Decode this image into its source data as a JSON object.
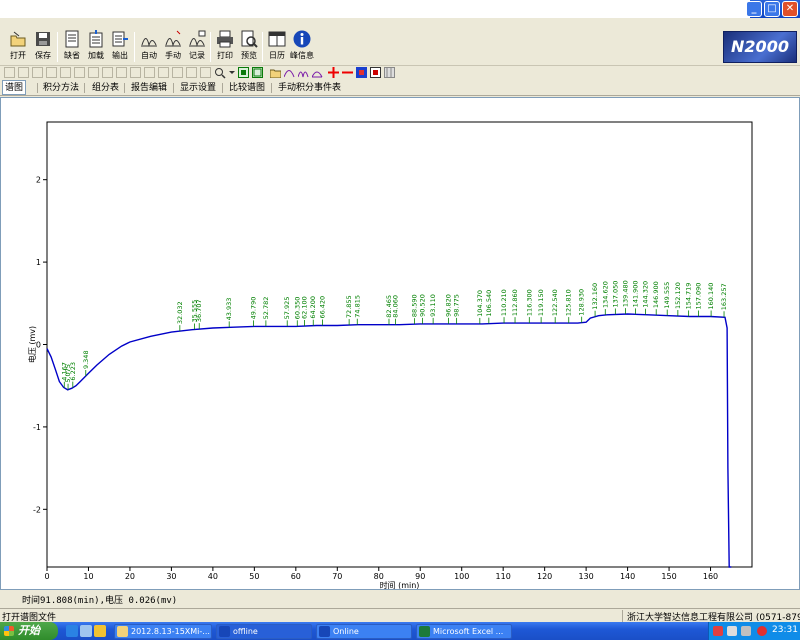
{
  "window": {
    "minimize_symbol": "_",
    "maximize_symbol": "□",
    "close_symbol": "✕"
  },
  "toolbar": {
    "buttons": [
      {
        "label": "打开",
        "icon": "open-icon"
      },
      {
        "label": "保存",
        "icon": "save-icon"
      },
      {
        "label": "缺省",
        "icon": "default-icon"
      },
      {
        "label": "加载",
        "icon": "load-icon"
      },
      {
        "label": "输出",
        "icon": "export-icon"
      },
      {
        "label": "自动",
        "icon": "auto-integrate-icon"
      },
      {
        "label": "手动",
        "icon": "manual-integrate-icon"
      },
      {
        "label": "记录",
        "icon": "record-icon"
      },
      {
        "label": "打印",
        "icon": "printer-icon"
      },
      {
        "label": "预览",
        "icon": "preview-icon"
      },
      {
        "label": "日历",
        "icon": "calendar-icon"
      },
      {
        "label": "峰信息",
        "icon": "info-icon"
      }
    ],
    "logo_text": "N2000"
  },
  "tabs": [
    {
      "label": "谱图",
      "active": true
    },
    {
      "label": "积分方法",
      "active": false
    },
    {
      "label": "组分表",
      "active": false
    },
    {
      "label": "报告编辑",
      "active": false
    },
    {
      "label": "显示设置",
      "active": false
    },
    {
      "label": "比较谱图",
      "active": false
    },
    {
      "label": "手动积分事件表",
      "active": false
    }
  ],
  "chart_data": {
    "type": "line",
    "xlabel": "时间 (min)",
    "ylabel": "电压 (mv)",
    "xlim": [
      0,
      170
    ],
    "ylim": [
      -2.7,
      2.7
    ],
    "xticks": [
      0,
      10,
      20,
      30,
      40,
      50,
      60,
      70,
      80,
      90,
      100,
      110,
      120,
      130,
      140,
      150,
      160
    ],
    "yticks": [
      -2,
      -1,
      0,
      1,
      2
    ],
    "line_color": "#0000c8",
    "peak_label_color": "#008000",
    "series": [
      {
        "x": [
          0,
          1,
          2,
          3,
          4,
          5,
          6,
          7,
          8,
          10,
          12,
          15,
          18,
          20,
          25,
          30,
          35,
          40,
          45,
          50,
          55,
          60,
          65,
          70,
          75,
          80,
          85,
          90,
          95,
          100,
          105,
          110,
          115,
          120,
          125,
          128,
          130,
          131,
          133,
          135,
          140,
          145,
          150,
          155,
          160,
          163.5,
          164,
          164.2,
          164.5,
          165
        ],
        "y": [
          -0.05,
          -0.15,
          -0.3,
          -0.45,
          -0.52,
          -0.55,
          -0.53,
          -0.5,
          -0.45,
          -0.35,
          -0.25,
          -0.12,
          -0.02,
          0.03,
          0.1,
          0.15,
          0.18,
          0.2,
          0.21,
          0.22,
          0.22,
          0.22,
          0.23,
          0.23,
          0.24,
          0.24,
          0.24,
          0.25,
          0.25,
          0.25,
          0.25,
          0.26,
          0.26,
          0.26,
          0.26,
          0.26,
          0.27,
          0.32,
          0.35,
          0.36,
          0.37,
          0.36,
          0.35,
          0.34,
          0.34,
          0.33,
          0.2,
          -1.5,
          -2.8,
          -2.8
        ]
      }
    ],
    "peak_labels": [
      {
        "x": 4.167,
        "text": "4.167"
      },
      {
        "x": 5.075,
        "text": "5.075"
      },
      {
        "x": 6.223,
        "text": "6.223"
      },
      {
        "x": 9.348,
        "text": "9.348"
      },
      {
        "x": 32.032,
        "text": "32.032"
      },
      {
        "x": 35.555,
        "text": "35.555"
      },
      {
        "x": 36.707,
        "text": "36.707"
      },
      {
        "x": 43.933,
        "text": "43.933"
      },
      {
        "x": 49.79,
        "text": "49.790"
      },
      {
        "x": 52.782,
        "text": "52.782"
      },
      {
        "x": 57.925,
        "text": "57.925"
      },
      {
        "x": 60.35,
        "text": "60.350"
      },
      {
        "x": 62.1,
        "text": "62.100"
      },
      {
        "x": 64.2,
        "text": "64.200"
      },
      {
        "x": 66.42,
        "text": "66.420"
      },
      {
        "x": 72.855,
        "text": "72.855"
      },
      {
        "x": 74.815,
        "text": "74.815"
      },
      {
        "x": 82.465,
        "text": "82.465"
      },
      {
        "x": 84.06,
        "text": "84.060"
      },
      {
        "x": 88.59,
        "text": "88.590"
      },
      {
        "x": 90.52,
        "text": "90.520"
      },
      {
        "x": 93.11,
        "text": "93.110"
      },
      {
        "x": 96.82,
        "text": "96.820"
      },
      {
        "x": 98.775,
        "text": "98.775"
      },
      {
        "x": 104.37,
        "text": "104.370"
      },
      {
        "x": 106.54,
        "text": "106.540"
      },
      {
        "x": 110.21,
        "text": "110.210"
      },
      {
        "x": 112.86,
        "text": "112.860"
      },
      {
        "x": 116.3,
        "text": "116.300"
      },
      {
        "x": 119.15,
        "text": "119.150"
      },
      {
        "x": 122.54,
        "text": "122.540"
      },
      {
        "x": 125.81,
        "text": "125.810"
      },
      {
        "x": 128.93,
        "text": "128.930"
      },
      {
        "x": 132.16,
        "text": "132.160"
      },
      {
        "x": 134.62,
        "text": "134.620"
      },
      {
        "x": 137.05,
        "text": "137.050"
      },
      {
        "x": 139.48,
        "text": "139.480"
      },
      {
        "x": 141.9,
        "text": "141.900"
      },
      {
        "x": 144.32,
        "text": "144.320"
      },
      {
        "x": 146.9,
        "text": "146.900"
      },
      {
        "x": 149.555,
        "text": "149.555"
      },
      {
        "x": 152.12,
        "text": "152.120"
      },
      {
        "x": 154.719,
        "text": "154.719"
      },
      {
        "x": 157.09,
        "text": "157.090"
      },
      {
        "x": 160.14,
        "text": "160.140"
      },
      {
        "x": 163.257,
        "text": "163.257"
      }
    ]
  },
  "readout": "时间91.808(min),电压 0.026(mv)",
  "statusbar": {
    "left": "打开谱图文件",
    "right": "浙江大学智达信息工程有限公司 (0571-87951175)"
  },
  "taskbar": {
    "start_label": "开始",
    "tasks": [
      {
        "label": "2012.8.13-15XMi-...",
        "icon": "folder-icon"
      },
      {
        "label": "offline",
        "icon": "app-icon"
      },
      {
        "label": "Online",
        "icon": "app-icon"
      },
      {
        "label": "Microsoft Excel ...",
        "icon": "excel-icon"
      }
    ],
    "clock": "23:31"
  }
}
